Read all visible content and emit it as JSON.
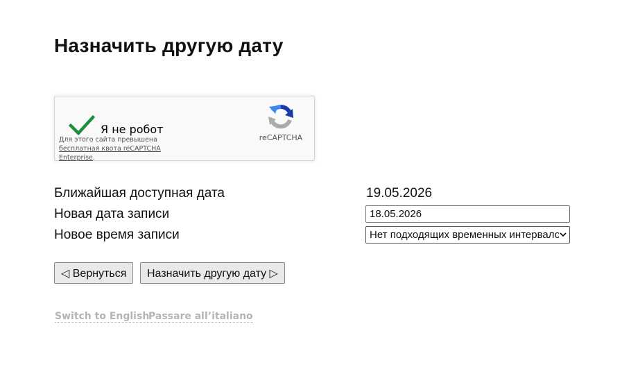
{
  "page": {
    "title": "Назначить другую дату"
  },
  "captcha": {
    "label": "Я не робот",
    "quota_prefix": "Для этого сайта превышена",
    "quota_link": "бесплатная квота reCAPTCHA Enterprise",
    "quota_suffix": ".",
    "brand": "reCAPTCHA",
    "checked": true,
    "check_color": "#1e8e3e"
  },
  "form": {
    "nearest_date_label": "Ближайшая доступная дата",
    "nearest_date_value": "19.05.2026",
    "new_date_label": "Новая дата записи",
    "new_date_value": "18.05.2026",
    "new_time_label": "Новое время записи",
    "new_time_selected": "Нет подходящих временных интервалов"
  },
  "buttons": {
    "back": "◁ Вернуться",
    "reschedule": "Назначить другую дату ▷"
  },
  "languages": {
    "english": "Switch to English",
    "italian": "Passare all’italiano"
  }
}
